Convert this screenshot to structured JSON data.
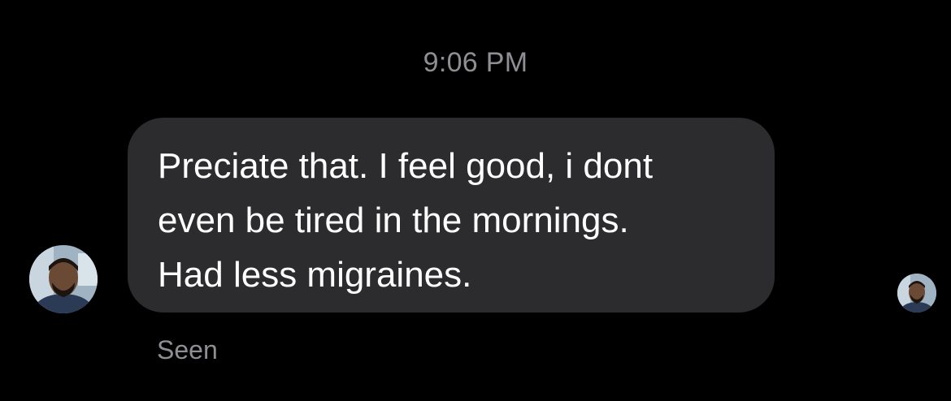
{
  "timestamp": "9:06 PM",
  "message": {
    "text": "Preciate that. I feel good, i dont\neven be tired in the mornings.\nHad less migraines.",
    "bubble_color": "#2c2c2e",
    "text_color": "#ffffff"
  },
  "status": {
    "seen_label": "Seen"
  },
  "avatars": {
    "sender_icon": "profile-photo",
    "reader_icon": "profile-photo"
  },
  "colors": {
    "background": "#000000",
    "secondary_text": "#8e8e93"
  }
}
